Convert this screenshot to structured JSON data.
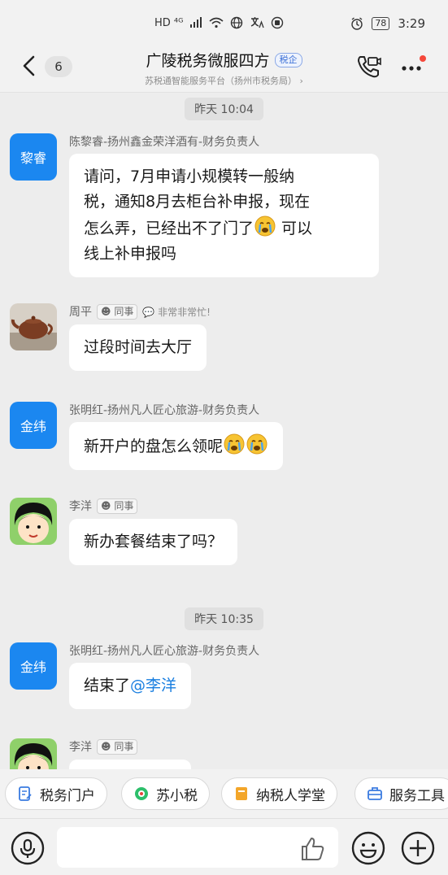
{
  "status_bar": {
    "network": "HD ⁴ᴳ",
    "battery": "78",
    "time": "3:29"
  },
  "header": {
    "unread_count": "6",
    "title": "广陵税务微服四方",
    "tag": "税企",
    "subtitle": "苏税通智能服务平台（扬州市税务局） ›"
  },
  "messages": [
    {
      "kind": "time",
      "text": "昨天 10:04"
    },
    {
      "kind": "msg",
      "avatar_text": "黎睿",
      "sender": "陈黎睿-扬州鑫金荣洋酒有-财务负责人",
      "lines": [
        "请问，7月申请小规模转一般纳",
        "税，通知8月去柜台补申报，现在",
        "怎么弄，已经出不了门了",
        "线上补申报吗"
      ],
      "line3_suffix": " 可以"
    },
    {
      "kind": "msg",
      "avatar_text": "",
      "sender": "周平",
      "colleague": "同事",
      "busy": "非常非常忙!",
      "text": "过段时间去大厅"
    },
    {
      "kind": "msg",
      "avatar_text": "金纬",
      "sender": "张明红-扬州凡人匠心旅游-财务负责人",
      "text": "新开户的盘怎么领呢"
    },
    {
      "kind": "msg",
      "avatar_text": "",
      "sender": "李洋",
      "colleague": "同事",
      "text": "新办套餐结束了吗？"
    },
    {
      "kind": "time",
      "text": "昨天 10:35"
    },
    {
      "kind": "msg",
      "avatar_text": "金纬",
      "sender": "张明红-扬州凡人匠心旅游-财务负责人",
      "text": "结束了",
      "mention": "@李洋"
    },
    {
      "kind": "msg",
      "avatar_text": "",
      "sender": "李洋",
      "colleague": "同事"
    }
  ],
  "quick_actions": [
    "税务门户",
    "苏小税",
    "纳税人学堂",
    "服务工具"
  ],
  "composer": {
    "value": ""
  },
  "colors": {
    "accent": "#1b87f0",
    "mention": "#1a7fe0",
    "notification_dot": "#f5483b"
  },
  "icons": [
    "back-icon",
    "video-call-icon",
    "more-icon",
    "voice-icon",
    "like-icon",
    "emoji-icon",
    "plus-icon"
  ]
}
